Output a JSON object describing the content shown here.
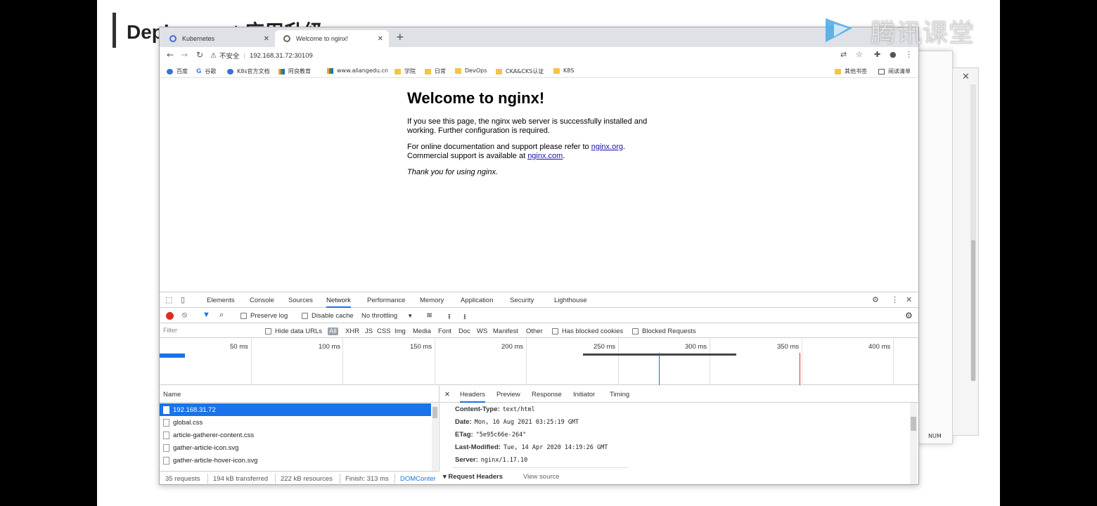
{
  "slide": {
    "title": "Deployment 应用升级",
    "logo_text": "腾讯课堂"
  },
  "browser": {
    "tabs": [
      {
        "label": "Kubernetes",
        "active": false
      },
      {
        "label": "Welcome to nginx!",
        "active": true
      }
    ],
    "new_tab": "+",
    "address": {
      "security": "不安全",
      "url": "192.168.31.72:30109"
    },
    "bookmarks": [
      "百度",
      "谷歌",
      "K8s官方文档",
      "阿良教育",
      "www.aliangedu.cn",
      "学院",
      "日常",
      "DevOps",
      "CKA&CKS认证",
      "K8S"
    ],
    "bookmarks_right": [
      "其他书签",
      "阅读清单"
    ]
  },
  "page": {
    "heading": "Welcome to nginx!",
    "para1": "If you see this page, the nginx web server is successfully installed and working. Further configuration is required.",
    "para2_pre": "For online documentation and support please refer to ",
    "link1": "nginx.org",
    "para2_mid": ". Commercial support is available at ",
    "link2": "nginx.com",
    "para2_post": ".",
    "thanks": "Thank you for using nginx."
  },
  "devtools": {
    "tabs": [
      "Elements",
      "Console",
      "Sources",
      "Network",
      "Performance",
      "Memory",
      "Application",
      "Security",
      "Lighthouse"
    ],
    "active_tab": "Network",
    "toolbar": {
      "preserve_log": "Preserve log",
      "disable_cache": "Disable cache",
      "throttling": "No throttling"
    },
    "filter": {
      "placeholder": "Filter",
      "hide_data_urls": "Hide data URLs",
      "types": [
        "All",
        "XHR",
        "JS",
        "CSS",
        "Img",
        "Media",
        "Font",
        "Doc",
        "WS",
        "Manifest",
        "Other"
      ],
      "has_blocked_cookies": "Has blocked cookies",
      "blocked_requests": "Blocked Requests"
    },
    "timeline_ticks": [
      "50 ms",
      "100 ms",
      "150 ms",
      "200 ms",
      "250 ms",
      "300 ms",
      "350 ms",
      "400 ms"
    ],
    "requests_header": "Name",
    "requests": [
      "192.168.31.72",
      "global.css",
      "article-gatherer-content.css",
      "gather-article-icon.svg",
      "gather-article-hover-icon.svg"
    ],
    "detail_tabs": [
      "Headers",
      "Preview",
      "Response",
      "Initiator",
      "Timing"
    ],
    "response_headers": [
      {
        "name": "Content-Type:",
        "value": "text/html"
      },
      {
        "name": "Date:",
        "value": "Mon, 16 Aug 2021 03:25:19 GMT"
      },
      {
        "name": "ETag:",
        "value": "\"5e95c66e-264\""
      },
      {
        "name": "Last-Modified:",
        "value": "Tue, 14 Apr 2020 14:19:26 GMT"
      },
      {
        "name": "Server:",
        "value": "nginx/1.17.10"
      }
    ],
    "request_headers_title": "▾ Request Headers",
    "view_source": "View source",
    "status": {
      "requests": "35 requests",
      "transferred": "194 kB transferred",
      "resources": "222 kB resources",
      "finish": "Finish: 313 ms",
      "domcontent": "DOMConter"
    }
  },
  "background_window": {
    "num_label": "NUM"
  },
  "colors": {
    "accent": "#1a73e8",
    "record": "#d93025",
    "link": "#1a0dab"
  }
}
